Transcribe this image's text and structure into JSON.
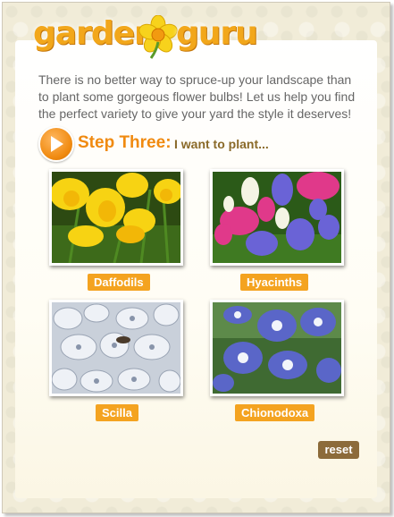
{
  "logo": {
    "word1": "garden",
    "word2": "guru"
  },
  "intro": "There is no better way to spruce-up your landscape than to plant some gorgeous flower bulbs! Let us help you find the perfect variety to give your yard the style it deserves!",
  "step": {
    "number": "Step Three:",
    "text": "I want to plant..."
  },
  "flowers": [
    {
      "label": "Daffodils"
    },
    {
      "label": "Hyacinths"
    },
    {
      "label": "Scilla"
    },
    {
      "label": "Chionodoxa"
    }
  ],
  "reset_label": "reset",
  "colors": {
    "accent": "#f08a10",
    "label_bg": "#f4a320",
    "reset_bg": "#8c6b3a"
  }
}
